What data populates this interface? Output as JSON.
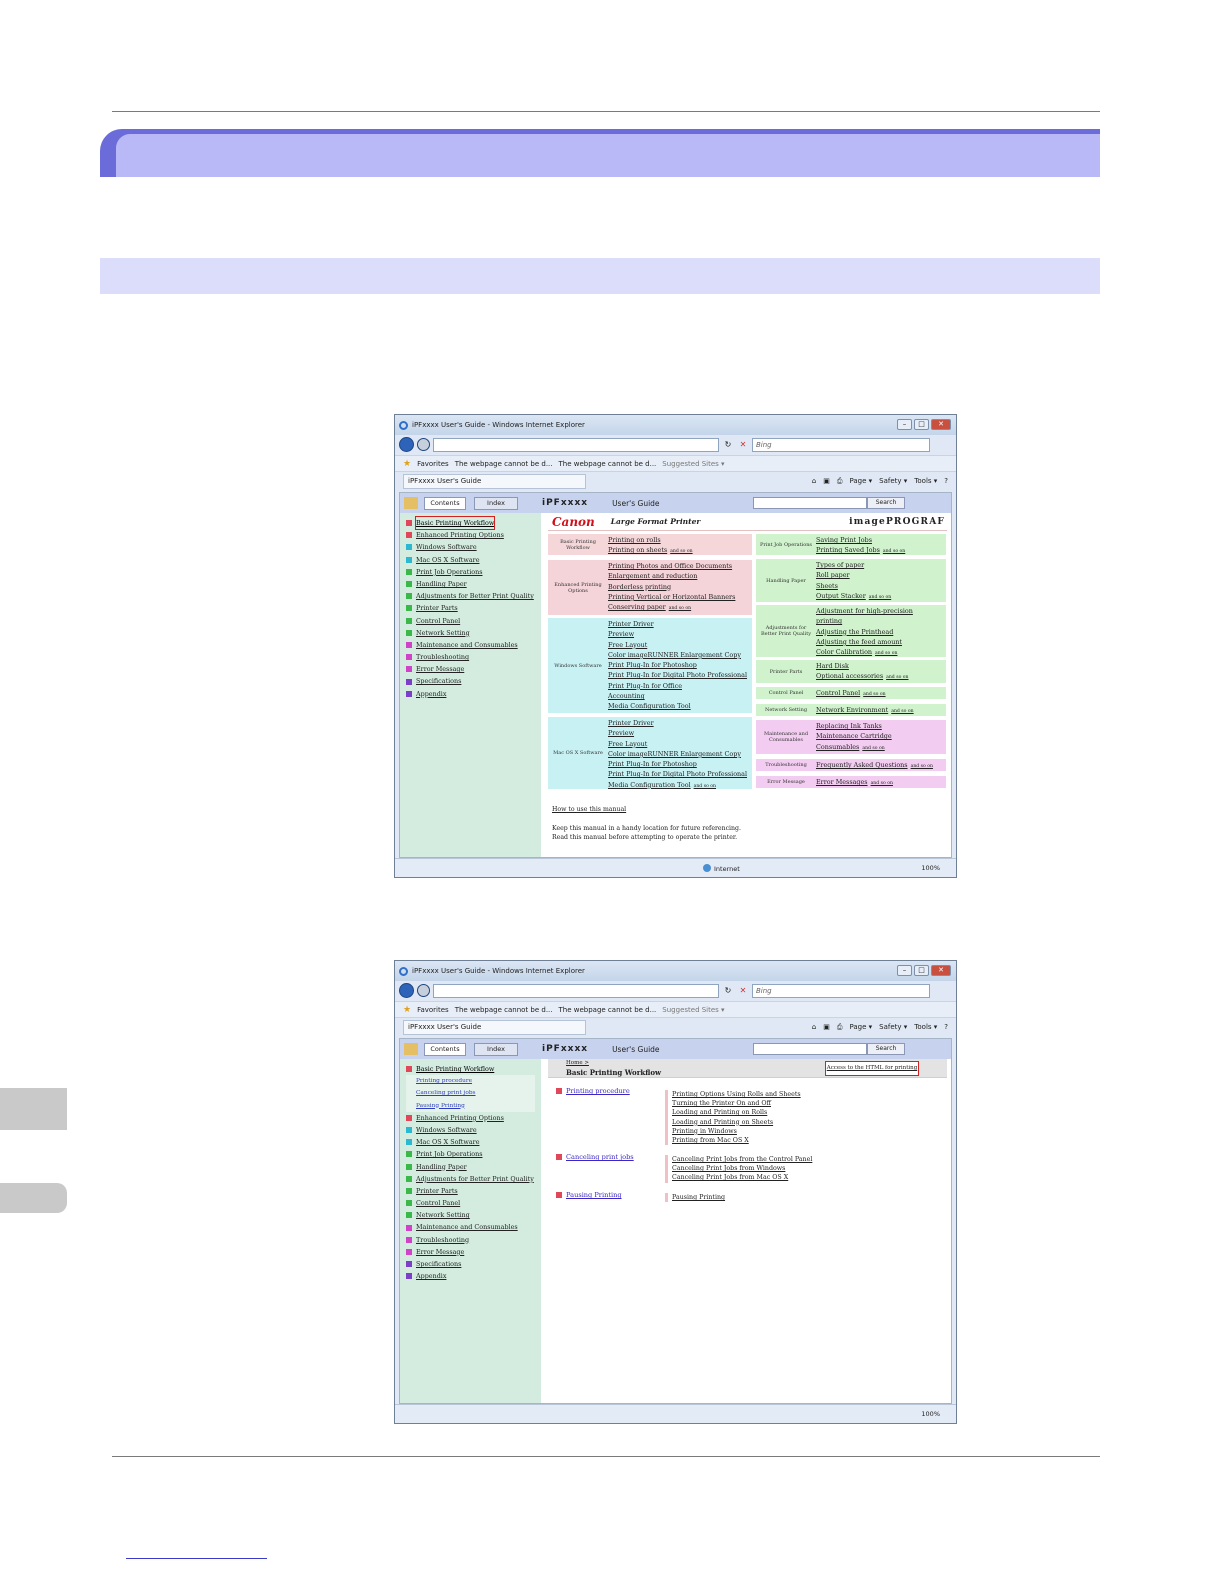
{
  "browser": {
    "window_title": "iPFxxxx  User's Guide - Windows Internet Explorer",
    "address_value": "",
    "search_placeholder": "Bing",
    "favorites_label": "Favorites",
    "fav_tab_1": "The webpage cannot be d...",
    "fav_tab_2": "The webpage cannot be d...",
    "suggested_sites": "Suggested Sites ▾",
    "tab_title": "iPFxxxx  User's Guide",
    "cmd_page": "Page ▾",
    "cmd_safety": "Safety ▾",
    "cmd_tools": "Tools ▾",
    "status_zone": "Internet",
    "zoom": "100%"
  },
  "guide": {
    "tab_contents": "Contents",
    "tab_index": "Index",
    "product": "iPFxxxx",
    "title": "User's Guide",
    "search_button": "Search",
    "brand_canon": "Canon",
    "brand_subtitle": "Large Format Printer",
    "brand_logo": "imagePROGRAF"
  },
  "nav": [
    {
      "label": "Basic Printing Workflow",
      "color": "#e0485a"
    },
    {
      "label": "Enhanced Printing Options",
      "color": "#e0485a"
    },
    {
      "label": "Windows Software",
      "color": "#2bb8d0"
    },
    {
      "label": "Mac OS X Software",
      "color": "#2bb8d0"
    },
    {
      "label": "Print Job Operations",
      "color": "#3bb84a"
    },
    {
      "label": "Handling Paper",
      "color": "#3bb84a"
    },
    {
      "label": "Adjustments for Better Print Quality",
      "color": "#3bb84a"
    },
    {
      "label": "Printer Parts",
      "color": "#3bb84a"
    },
    {
      "label": "Control Panel",
      "color": "#3bb84a"
    },
    {
      "label": "Network Setting",
      "color": "#3bb84a"
    },
    {
      "label": "Maintenance and Consumables",
      "color": "#d042c8"
    },
    {
      "label": "Troubleshooting",
      "color": "#d042c8"
    },
    {
      "label": "Error Message",
      "color": "#d042c8"
    },
    {
      "label": "Specifications",
      "color": "#7b3fc8"
    },
    {
      "label": "Appendix",
      "color": "#7b3fc8"
    }
  ],
  "nav_sub": [
    "Printing procedure",
    "Canceling print jobs",
    "Pausing Printing"
  ],
  "left_blocks": [
    {
      "label": "Basic Printing Workflow",
      "links": [
        "Printing on rolls",
        "Printing on sheets"
      ]
    },
    {
      "label": "Enhanced Printing Options",
      "links": [
        "Printing Photos and Office Documents",
        "Enlargement and reduction",
        "Borderless printing",
        "Printing Vertical or Horizontal Banners",
        "Conserving paper"
      ]
    },
    {
      "label": "Windows Software",
      "links": [
        "Printer Driver",
        "Preview",
        "Free Layout",
        "Color imageRUNNER Enlargement Copy",
        "Print Plug-In for Photoshop",
        "Print Plug-In for Digital Photo Professional",
        "Print Plug-In for Office",
        "Accounting",
        "Media Configuration Tool"
      ]
    },
    {
      "label": "Mac OS X Software",
      "links": [
        "Printer Driver",
        "Preview",
        "Free Layout",
        "Color imageRUNNER Enlargement Copy",
        "Print Plug-In for Photoshop",
        "Print Plug-In for Digital Photo Professional",
        "Media Configuration Tool"
      ]
    }
  ],
  "right_blocks": [
    {
      "label": "Print Job Operations",
      "links": [
        "Saving Print Jobs",
        "Printing Saved Jobs"
      ]
    },
    {
      "label": "Handling Paper",
      "links": [
        "Types of paper",
        "Roll paper",
        "Sheets",
        "Output Stacker"
      ]
    },
    {
      "label": "Adjustments for Better Print Quality",
      "links": [
        "Adjustment for high-precision",
        "printing",
        "Adjusting the Printhead",
        "Adjusting the feed amount",
        "Color Calibration"
      ]
    },
    {
      "label": "Printer Parts",
      "links": [
        "Hard Disk",
        "Optional accessories"
      ]
    },
    {
      "label": "Control Panel",
      "links": [
        "Control Panel"
      ]
    },
    {
      "label": "Network Setting",
      "links": [
        "Network Environment"
      ]
    },
    {
      "label": "Maintenance and Consumables",
      "links": [
        "Replacing Ink Tanks",
        "Maintenance Cartridge",
        "Consumables"
      ]
    },
    {
      "label": "Troubleshooting",
      "links": [
        "Frequently Asked Questions"
      ]
    },
    {
      "label": "Error Message",
      "links": [
        "Error Messages"
      ]
    }
  ],
  "and_so_on": "and so on",
  "how_to_use": "How to use this manual",
  "keep_text_1": "Keep this manual in a handy location for future referencing.",
  "keep_text_2": "Read this manual before attempting to operate the printer.",
  "workflow_page": {
    "crumb": "Home >",
    "title": "Basic Printing Workflow",
    "print_html_button": "Access to the HTML for printing",
    "topics": [
      {
        "label": "Printing procedure",
        "links": [
          "Printing Options Using Rolls and Sheets",
          "Turning the Printer On and Off",
          "Loading and Printing on Rolls",
          "Loading and Printing on Sheets",
          "Printing in Windows",
          "Printing from Mac OS X"
        ]
      },
      {
        "label": "Canceling print jobs",
        "links": [
          "Canceling Print Jobs from the Control Panel",
          "Canceling Print Jobs from Windows",
          "Canceling Print Jobs from Mac OS X"
        ]
      },
      {
        "label": "Pausing Printing",
        "links": [
          "Pausing Printing"
        ]
      }
    ]
  }
}
